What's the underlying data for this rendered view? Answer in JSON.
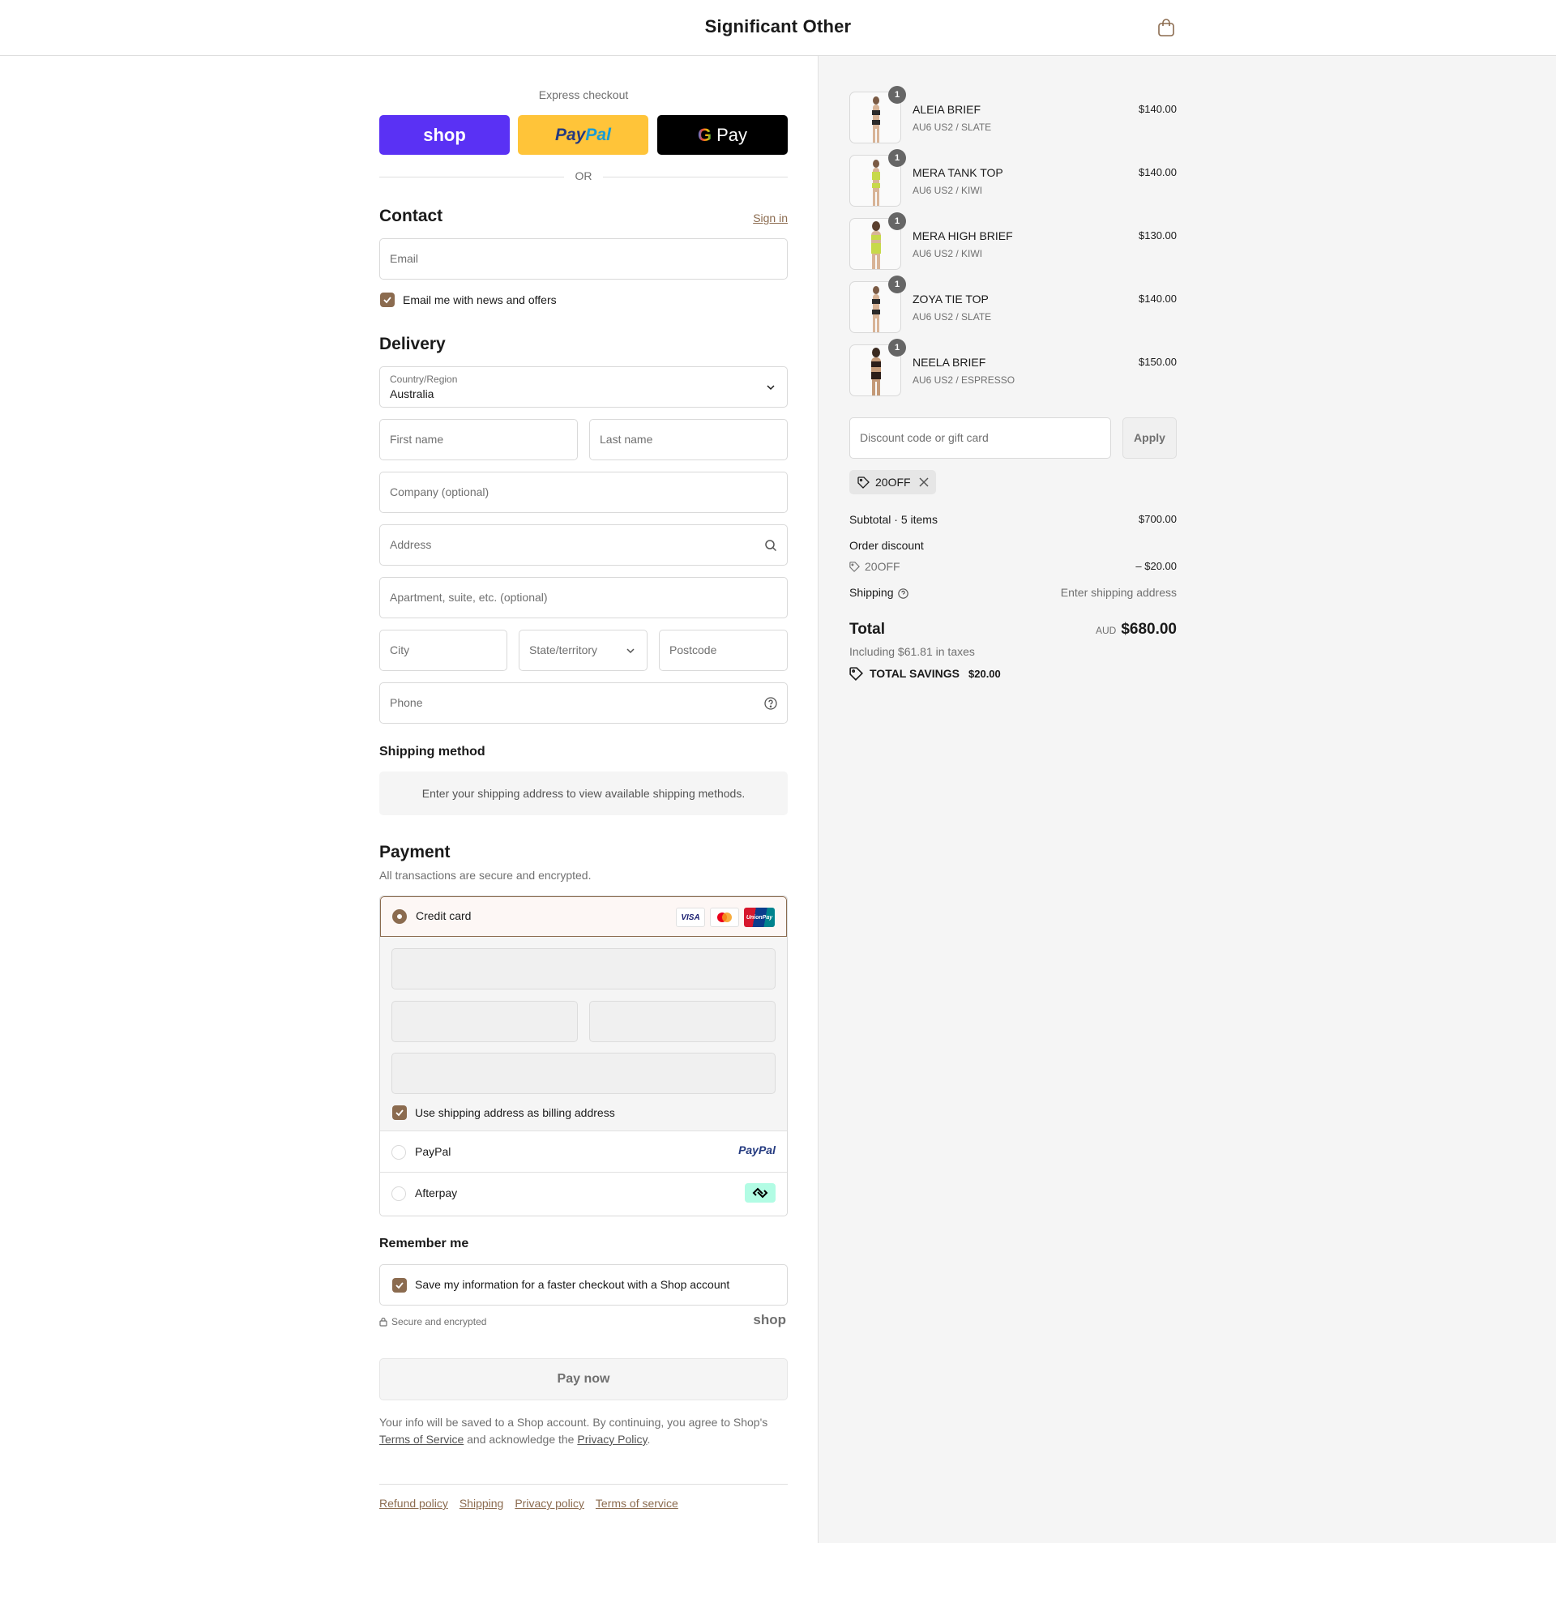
{
  "header": {
    "brand": "Significant Other"
  },
  "express": {
    "label": "Express checkout",
    "shop_label": "shop",
    "paypal_label_1": "Pay",
    "paypal_label_2": "Pal",
    "gpay_g": "G",
    "gpay_label": "Pay",
    "or_label": "OR"
  },
  "contact": {
    "title": "Contact",
    "sign_in": "Sign in",
    "email_placeholder": "Email",
    "news_label": "Email me with news and offers"
  },
  "delivery": {
    "title": "Delivery",
    "country_label": "Country/Region",
    "country_value": "Australia",
    "first_name": "First name",
    "last_name": "Last name",
    "company": "Company (optional)",
    "address": "Address",
    "apartment": "Apartment, suite, etc. (optional)",
    "city": "City",
    "state": "State/territory",
    "postcode": "Postcode",
    "phone": "Phone"
  },
  "shipping_method": {
    "title": "Shipping method",
    "message": "Enter your shipping address to view available shipping methods."
  },
  "payment": {
    "title": "Payment",
    "subtitle": "All transactions are secure and encrypted.",
    "credit_card": "Credit card",
    "card_logos": [
      "VISA",
      "Mastercard",
      "UnionPay"
    ],
    "unionpay_text": "UnionPay",
    "billing_label": "Use shipping address as billing address",
    "paypal": "PayPal",
    "paypal_logo": "PayPal",
    "afterpay": "Afterpay"
  },
  "remember": {
    "title": "Remember me",
    "save_label": "Save my information for a faster checkout with a Shop account",
    "secure": "Secure and encrypted",
    "shop_logo": "shop"
  },
  "pay_now": "Pay now",
  "legal": {
    "text1": "Your info will be saved to a Shop account. By continuing, you agree to Shop's ",
    "tos": "Terms of Service",
    "text2": " and acknowledge the ",
    "privacy": "Privacy Policy",
    "text3": "."
  },
  "footer": {
    "links": [
      "Refund policy",
      "Shipping",
      "Privacy policy",
      "Terms of service"
    ]
  },
  "cart": {
    "items": [
      {
        "name": "ALEIA BRIEF",
        "variant": "AU6 US2 / SLATE",
        "price": "$140.00",
        "qty": "1",
        "color": "#2a2a2a"
      },
      {
        "name": "MERA TANK TOP",
        "variant": "AU6 US2 / KIWI",
        "price": "$140.00",
        "qty": "1",
        "color": "#c7d94a"
      },
      {
        "name": "MERA HIGH BRIEF",
        "variant": "AU6 US2 / KIWI",
        "price": "$130.00",
        "qty": "1",
        "color": "#c7d94a"
      },
      {
        "name": "ZOYA TIE TOP",
        "variant": "AU6 US2 / SLATE",
        "price": "$140.00",
        "qty": "1",
        "color": "#2a2a2a"
      },
      {
        "name": "NEELA BRIEF",
        "variant": "AU6 US2 / ESPRESSO",
        "price": "$150.00",
        "qty": "1",
        "color": "#2b1d18"
      }
    ],
    "discount_placeholder": "Discount code or gift card",
    "apply": "Apply",
    "applied_code": "20OFF",
    "subtotal_label": "Subtotal · 5 items",
    "subtotal_value": "$700.00",
    "order_discount_label": "Order discount",
    "discount_code": "20OFF",
    "discount_value": "– $20.00",
    "shipping_label": "Shipping",
    "shipping_value": "Enter shipping address",
    "total_label": "Total",
    "currency": "AUD",
    "total_value": "$680.00",
    "taxes": "Including $61.81 in taxes",
    "savings_label": "TOTAL SAVINGS",
    "savings_value": "$20.00"
  },
  "colors": {
    "accent": "#8b6b4f",
    "shop_purple": "#5a31f4",
    "paypal_yellow": "#ffc439"
  }
}
